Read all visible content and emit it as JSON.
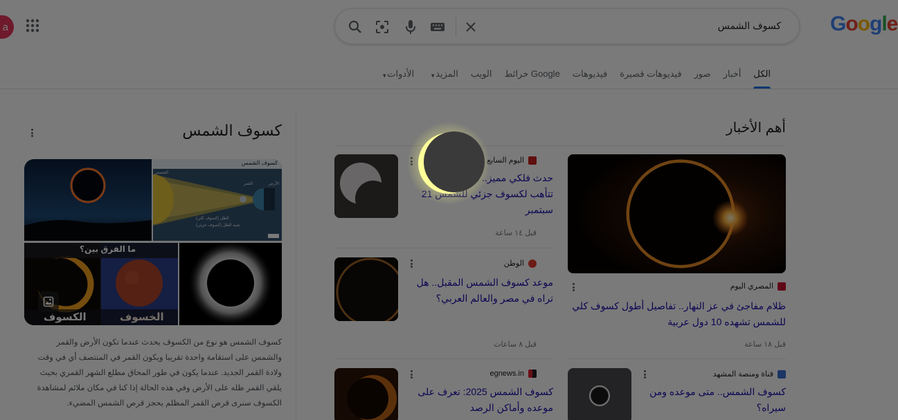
{
  "logo": "Google",
  "search": {
    "query": "كسوف الشمس"
  },
  "user": {
    "avatar_letter": "a"
  },
  "tabs": [
    {
      "label": "الكل",
      "active": true
    },
    {
      "label": "أخبار"
    },
    {
      "label": "صور"
    },
    {
      "label": "فيديوهات قصيرة"
    },
    {
      "label": "فيديوهات"
    },
    {
      "label": "خرائط Google"
    },
    {
      "label": "الويب"
    },
    {
      "label": "المزيد",
      "dropdown": true
    },
    {
      "label": "الأدوات",
      "dropdown": true
    }
  ],
  "news": {
    "heading": "أهم الأخبار",
    "cards": [
      {
        "source": "المصري اليوم",
        "title": "ظلام مفاجئ في عز النهار.. تفاصيل أطول كسوف كلي للشمس تشهده 10 دول عربية",
        "time": "قبل ١٨ ساعة"
      },
      {
        "source": "اليوم السابع",
        "title": "حدث فلكي مميز.. الكرة الأرضية تتأهب لكسوف جزئي للشمس 21 سبتمبر",
        "time": "قبل ١٤ ساعة"
      },
      {
        "source": "الوطن",
        "title": "موعد كسوف الشمس المقبل.. هل تراه في مصر والعالم العربي؟",
        "time": "قبل ٨ ساعات"
      },
      {
        "source": "قناة ومنصة المشهد",
        "title": "كسوف الشمس.. متى موعده ومن سيراه؟"
      },
      {
        "source": "egnews.in",
        "title": "كسوف الشمس 2025: تعرف على موعده وأماكن الرصد"
      }
    ]
  },
  "knowledge_panel": {
    "title": "كسوف الشمس",
    "diagram_title": "كسوف الشمس",
    "diagram_labels": {
      "moon": "القمر",
      "earth": "الأرض",
      "sun": "الشمس",
      "umbra": "الظل (كسوف كلي)",
      "penumbra": "شبه الظل (كسوف جزئي)"
    },
    "compare_title": "ما الفرق بين؟",
    "solar_label": "الكسوف",
    "lunar_label": "الخسوف",
    "description": "كسوف الشمس هو نوع من الكسوف يحدث عندما تكون الأرض والقمر والشمس على استقامة واحدة تقريبا ويكون القمر في المنتصف أي في وقت ولادة القمر الجديد. عندما يكون في طور المحاق مطلع الشهر القمري بحيث يلقي القمر ظله على الأرض وفي هذه الحالة إذا كنا في مكان ملائم لمشاهدة الكسوف سنرى قرص القمر المظلم يحجز قرص الشمس المضيء."
  },
  "colors": {
    "link": "#1a0dab",
    "accent": "#1a73e8",
    "overlay": "rgba(0,0,0,0.52)"
  }
}
